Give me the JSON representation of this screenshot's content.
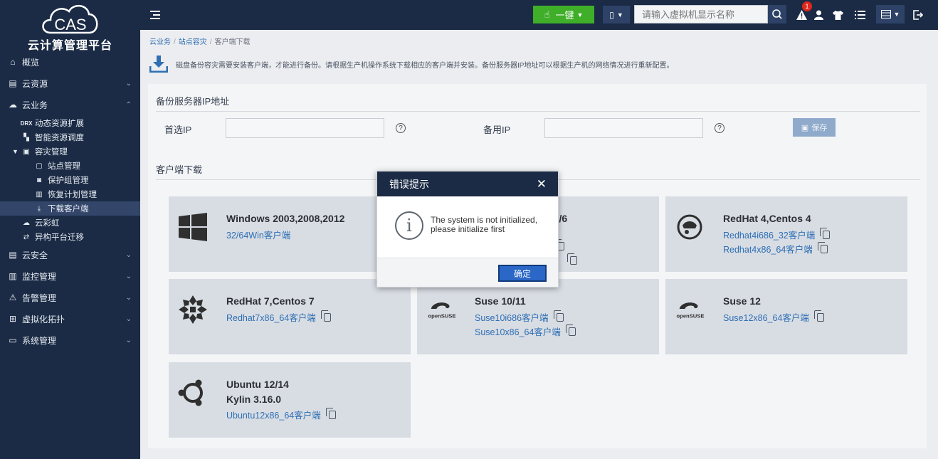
{
  "brand": {
    "logo_text": "CAS",
    "platform_title": "云计算管理平台"
  },
  "sidebar": {
    "items": [
      {
        "label": "概览",
        "icon": "home-icon"
      },
      {
        "label": "云资源",
        "icon": "resource-icon"
      },
      {
        "label": "云业务",
        "icon": "cloud-icon"
      }
    ],
    "cloud_sub": [
      {
        "label": "动态资源扩展",
        "icon": "drx-icon"
      },
      {
        "label": "智能资源调度",
        "icon": "schedule-icon"
      },
      {
        "label": "容灾管理",
        "icon": "disaster-icon"
      }
    ],
    "disaster_sub": [
      {
        "label": "站点管理",
        "icon": "site-icon"
      },
      {
        "label": "保护组管理",
        "icon": "protect-icon"
      },
      {
        "label": "恢复计划管理",
        "icon": "plan-icon"
      },
      {
        "label": "下载客户端",
        "icon": "download-icon"
      }
    ],
    "cloud_sub2": [
      {
        "label": "云彩虹",
        "icon": "rainbow-icon"
      },
      {
        "label": "异构平台迁移",
        "icon": "migrate-icon"
      }
    ],
    "items2": [
      {
        "label": "云安全",
        "icon": "security-icon"
      },
      {
        "label": "监控管理",
        "icon": "monitor-icon"
      },
      {
        "label": "告警管理",
        "icon": "alarm-icon"
      },
      {
        "label": "虚拟化拓扑",
        "icon": "topology-icon"
      },
      {
        "label": "系统管理",
        "icon": "system-icon"
      }
    ]
  },
  "topbar": {
    "onekey_label": "一键",
    "search_placeholder": "请输入虚拟机显示名称",
    "alert_count": "1"
  },
  "breadcrumb": {
    "item1": "云业务",
    "item2": "站点容灾",
    "item3": "客户端下载"
  },
  "notice": "磁盘备份容灾需要安装客户端，才能进行备份。请根据生产机操作系统下载相应的客户端并安装。备份服务器IP地址可以根据生产机的网络情况进行重新配置。",
  "backup_server": {
    "section_title": "备份服务器IP地址",
    "primary_label": "首选IP",
    "primary_value": "",
    "secondary_label": "备用IP",
    "secondary_value": "",
    "help": "?",
    "save_label": "保存"
  },
  "downloads": {
    "section_title": "客户端下载",
    "cards": [
      {
        "title": "Windows 2003,2008,2012",
        "links": [
          "32/64Win客户端"
        ],
        "icon": "windows-icon"
      },
      {
        "title": "s 5/6",
        "links": [
          "",
          ""
        ],
        "icon": "centos-icon"
      },
      {
        "title": "RedHat 4,Centos 4",
        "links": [
          "Redhat4i686_32客户端",
          "Redhat4x86_64客户端"
        ],
        "icon": "redhat-icon"
      },
      {
        "title": "RedHat 7,Centos 7",
        "links": [
          "Redhat7x86_64客户端"
        ],
        "icon": "centos-icon"
      },
      {
        "title": "Suse 10/11",
        "links": [
          "Suse10i686客户端",
          "Suse10x86_64客户端"
        ],
        "icon": "opensuse-icon"
      },
      {
        "title": "Suse 12",
        "links": [
          "Suse12x86_64客户端"
        ],
        "icon": "opensuse-icon"
      },
      {
        "title": "Ubuntu 12/14",
        "title2": "Kylin 3.16.0",
        "links": [
          "Ubuntu12x86_64客户端"
        ],
        "icon": "ubuntu-icon"
      }
    ]
  },
  "modal": {
    "title": "错误提示",
    "close": "✕",
    "message": "The system is not initialized, please initialize first",
    "ok_label": "确定"
  },
  "colors": {
    "nav_bg": "#1b2b45",
    "accent_green": "#3fae29",
    "link_blue": "#2f6fb3",
    "badge_red": "#e0261d"
  }
}
